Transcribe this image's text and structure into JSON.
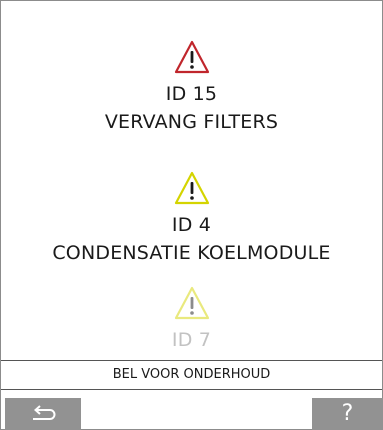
{
  "alarms": [
    {
      "id_label": "ID 15",
      "message": "VERVANG FILTERS",
      "severity": "error",
      "color": "#c0262c"
    },
    {
      "id_label": "ID 4",
      "message": "CONDENSATIE KOELMODULE",
      "severity": "warning",
      "color": "#d4d400"
    },
    {
      "id_label": "ID 7",
      "message": "",
      "severity": "warning",
      "color": "#d4d400"
    }
  ],
  "footer": {
    "call_service": "BEL VOOR ONDERHOUD",
    "back_icon": "return-arrow-icon",
    "help_label": "?"
  },
  "colors": {
    "error": "#c0262c",
    "warning": "#d4d400",
    "button": "#929292"
  }
}
